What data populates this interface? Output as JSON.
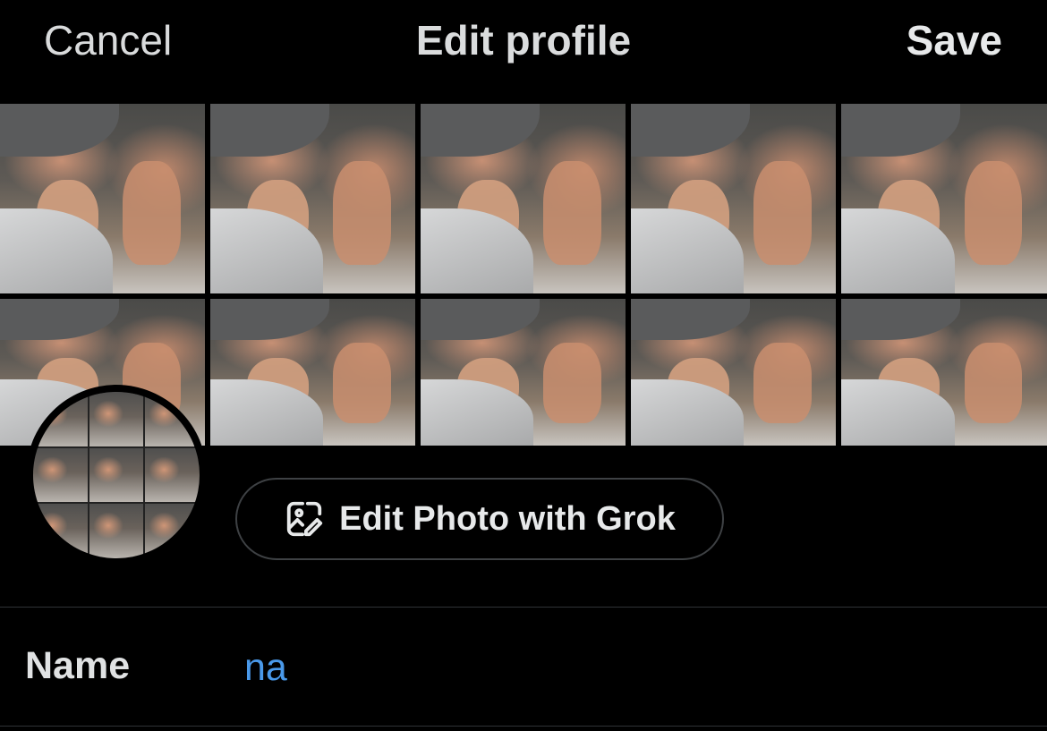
{
  "header": {
    "cancel_label": "Cancel",
    "title": "Edit profile",
    "save_label": "Save"
  },
  "banner": {
    "photo_grid_columns": 5,
    "photo_grid_rows": 2
  },
  "avatar": {
    "photo_grid_columns": 3,
    "photo_grid_rows": 3
  },
  "grok_button": {
    "icon": "image-edit-icon",
    "label": "Edit Photo with Grok"
  },
  "fields": {
    "name": {
      "label": "Name",
      "value": "na"
    }
  },
  "colors": {
    "background": "#000000",
    "text": "#e7e9ea",
    "input_value": "#4a99e9",
    "divider": "#2f3336",
    "button_border": "#3e4144"
  }
}
